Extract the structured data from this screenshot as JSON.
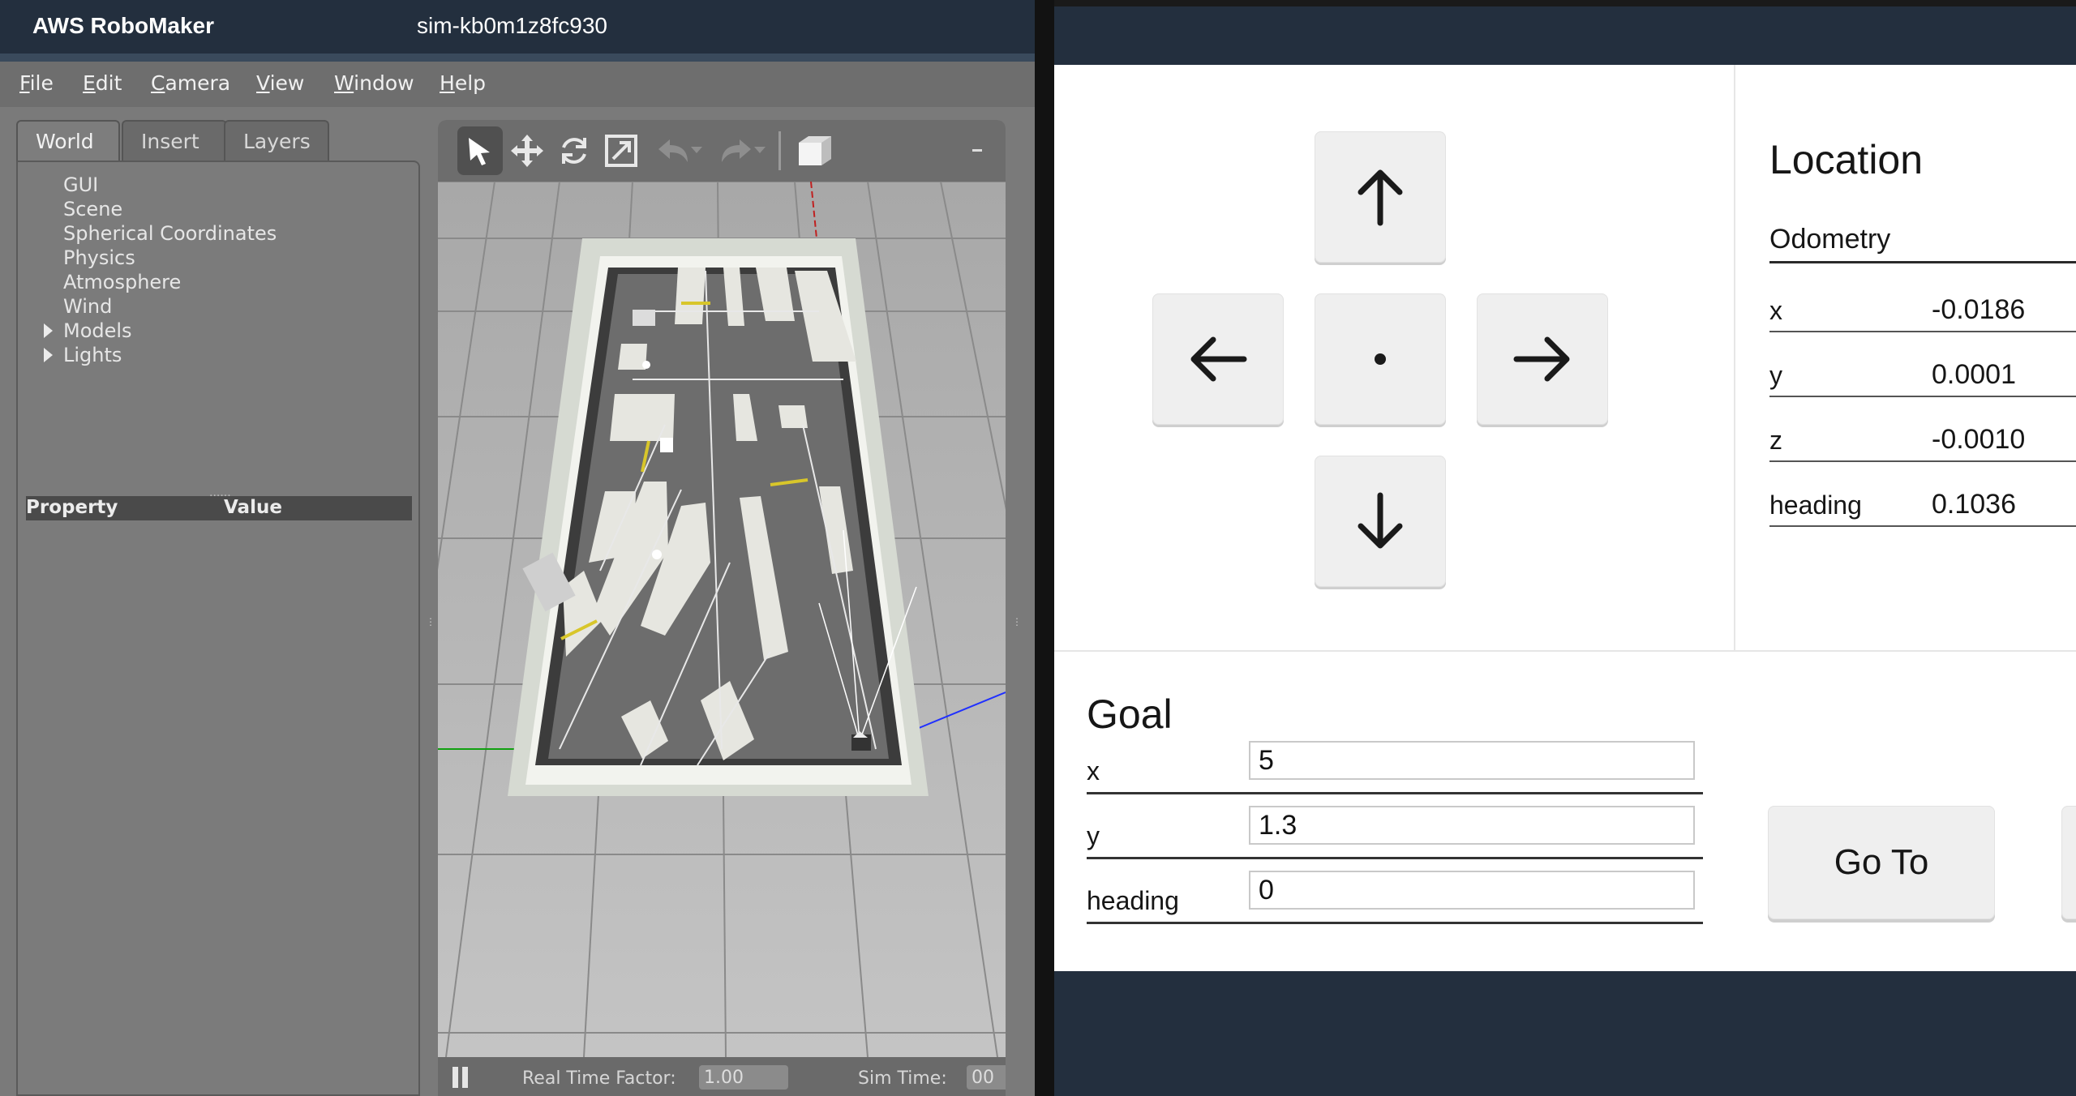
{
  "robomaker": {
    "brand": "AWS RoboMaker",
    "sim_id": "sim-kb0m1z8fc930"
  },
  "gazebo": {
    "menu": [
      {
        "first": "F",
        "rest": "ile"
      },
      {
        "first": "E",
        "rest": "dit"
      },
      {
        "first": "C",
        "rest": "amera"
      },
      {
        "first": "V",
        "rest": "iew"
      },
      {
        "first": "W",
        "rest": "indow"
      },
      {
        "first": "H",
        "rest": "elp"
      }
    ],
    "tabs": [
      "World",
      "Insert",
      "Layers"
    ],
    "tree": [
      "GUI",
      "Scene",
      "Spherical Coordinates",
      "Physics",
      "Atmosphere",
      "Wind",
      "Models",
      "Lights"
    ],
    "property_header": {
      "property": "Property",
      "value": "Value"
    },
    "bottom": {
      "rtf_label": "Real Time Factor:",
      "rtf_value": "1.00",
      "sim_time_label": "Sim Time:",
      "sim_time_value": "00"
    },
    "toolbar_icons": [
      "select-arrow-icon",
      "translate-icon",
      "rotate-icon",
      "scale-icon",
      "undo-icon",
      "redo-icon",
      "box-shape-icon"
    ]
  },
  "control": {
    "teleop_icons": [
      "arrow-up-icon",
      "arrow-left-icon",
      "stop-dot-icon",
      "arrow-right-icon",
      "arrow-down-icon"
    ],
    "location": {
      "title": "Location",
      "odometry_label": "Odometry",
      "rows": [
        {
          "key": "x",
          "value": "-0.0186"
        },
        {
          "key": "y",
          "value": "0.0001"
        },
        {
          "key": "z",
          "value": "-0.0010"
        },
        {
          "key": "heading",
          "value": "0.1036"
        }
      ]
    },
    "goal": {
      "title": "Goal",
      "rows": [
        {
          "key": "x",
          "value": "5"
        },
        {
          "key": "y",
          "value": "1.3"
        },
        {
          "key": "heading",
          "value": "0"
        }
      ],
      "go_to_label": "Go To"
    }
  }
}
